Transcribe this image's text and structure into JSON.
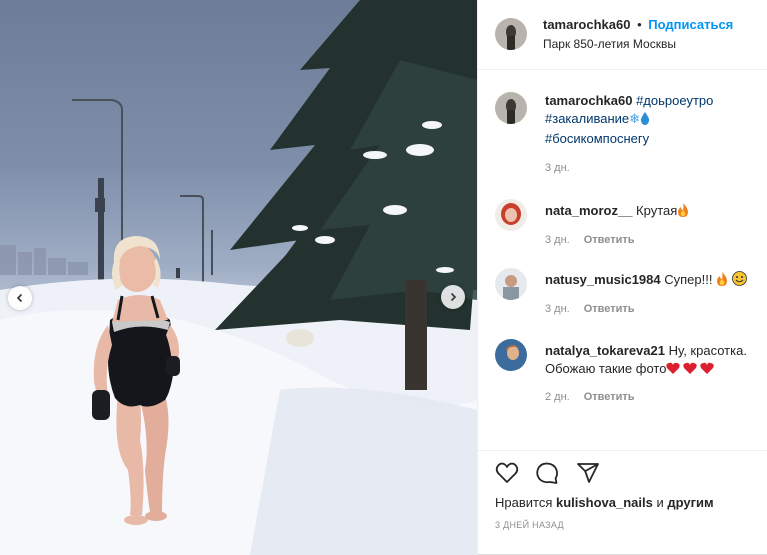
{
  "post": {
    "author": "tamarochka60",
    "separator": "•",
    "follow_label": "Подписаться",
    "location": "Парк 850-летия Москвы"
  },
  "caption": {
    "author": "tamarochka60",
    "line1_tag": "#доьроеутро",
    "line2_tag": "#закаливание",
    "line3_tag": "#босикомпоснегу",
    "time": "3 дн."
  },
  "comments": [
    {
      "author": "nata_moroz__",
      "text": "Крутая",
      "emoji": "fire",
      "time": "3 дн.",
      "reply": "Ответить"
    },
    {
      "author": "natusy_music1984",
      "text": "Супер!!!",
      "emoji": "fire, smile",
      "time": "3 дн.",
      "reply": "Ответить"
    },
    {
      "author": "natalya_tokareva21",
      "text": "Ну, красотка. Обожаю такие фото",
      "emoji": "hearts",
      "time": "2 дн.",
      "reply": "Ответить"
    }
  ],
  "likes": {
    "prefix": "Нравится",
    "user": "kulishova_nails",
    "middle": "и",
    "others": "другим"
  },
  "date": "3 ДНЕЙ НАЗАД",
  "colors": {
    "accent": "#0095f6",
    "hashtag": "#00376b",
    "muted": "#8e8e8e",
    "heart": "#ed4956"
  },
  "icons": [
    "chevron-left-icon",
    "chevron-right-icon",
    "heart-icon",
    "comment-icon",
    "share-icon"
  ]
}
